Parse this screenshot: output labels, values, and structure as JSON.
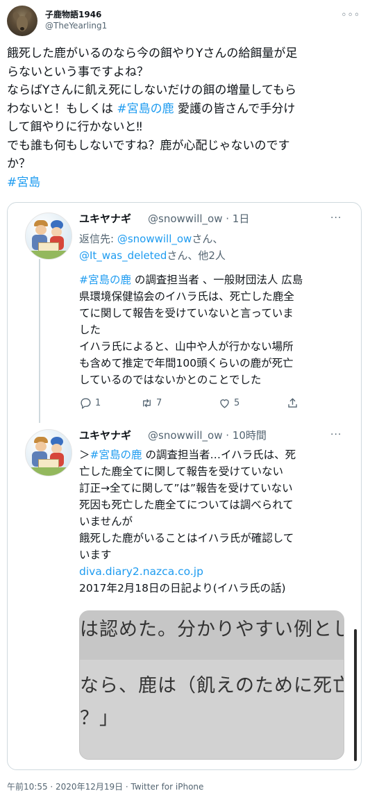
{
  "author": {
    "name": "子鹿物語1946",
    "handle": "@TheYearling1",
    "avatar_icon": "deer-avatar"
  },
  "more_glyph": "◦◦◦",
  "tweet_lines": [
    {
      "t": "餓死した鹿がいるのなら今の餌やりYさんの給餌量が足"
    },
    {
      "t": "らないという事ですよね？"
    },
    {
      "t": "ならばYさんに飢え死にしないだけの餌の増量してもら"
    },
    {
      "pre": "わないと！もしくは ",
      "link": "#宮島の鹿",
      "post": " 愛護の皆さんで手分け"
    },
    {
      "t": "して餌やりに行かないと‼"
    },
    {
      "t": "でも誰も何もしないですね？鹿が心配じゃないのです"
    },
    {
      "t": "か？"
    },
    {
      "link": "#宮島"
    }
  ],
  "quoted": {
    "first": {
      "name": "ユキヤナギ",
      "meta": "@snowwill_ow · 1日",
      "more_glyph": "···",
      "replying_prefix": "返信先: ",
      "replying_link1": "@snowwill_ow",
      "replying_suffix1": "さん、",
      "replying_link2": "@It_was_deleted",
      "replying_suffix2": "さん、他2人",
      "lines": [
        {
          "link": "#宮島の鹿",
          "post": " の調査担当者 、一般財団法人 広島"
        },
        {
          "t": "県環境保健協会のイハラ氏は、死亡した鹿全"
        },
        {
          "t": "てに関して報告を受けていないと言っていま"
        },
        {
          "t": "した"
        },
        {
          "t": "イハラ氏によると、山中や人が行かない場所"
        },
        {
          "t": "も含めて推定で年間100頭くらいの鹿が死亡"
        },
        {
          "t": "しているのではないかとのことでした"
        }
      ],
      "actions": {
        "reply_count": "1",
        "retweet_count": "7",
        "like_count": "5"
      }
    },
    "second": {
      "name": "ユキヤナギ",
      "meta": "@snowwill_ow · 10時間",
      "more_glyph": "···",
      "lines": [
        {
          "pre": "＞",
          "link": "#宮島の鹿",
          "post": " の調査担当者…イハラ氏は、死"
        },
        {
          "t": "亡した鹿全てに関して報告を受けていない"
        },
        {
          "t": "訂正→全てに関して”は”報告を受けていない"
        },
        {
          "t": "死因も死亡した鹿全てについては調べられて"
        },
        {
          "t": "いませんが"
        },
        {
          "t": "餓死した鹿がいることはイハラ氏が確認して"
        },
        {
          "t": "います"
        },
        {
          "link": "diva.diary2.nazca.co.jp"
        },
        {
          "t": "2017年2月18日の日記より(イハラ氏の話)"
        }
      ],
      "media_lines": [
        "は認めた。分かりやすい例とし",
        "なら、鹿は（飢えのために死亡",
        "？」"
      ]
    }
  },
  "footer": "午前10:55 · 2020年12月19日 · Twitter for iPhone",
  "colors": {
    "link": "#1d9bf0",
    "text": "#0f1419",
    "muted": "#536471",
    "border": "#cfd9de"
  }
}
